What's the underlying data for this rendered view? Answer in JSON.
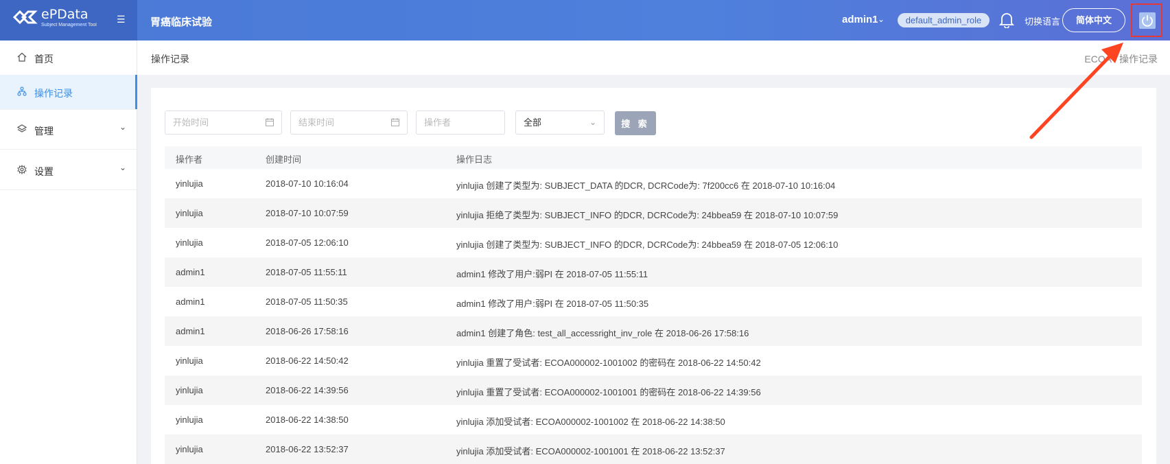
{
  "header": {
    "logo_text": "ePData",
    "logo_sub": "Subject Management Tool",
    "project_title": "胃癌临床试验",
    "user": "admin1",
    "role": "default_admin_role",
    "lang_label": "切换语言",
    "lang_button": "简体中文",
    "accent": "#4a78d6"
  },
  "sidebar": {
    "items": [
      {
        "label": "首页",
        "icon": "home-icon"
      },
      {
        "label": "操作记录",
        "icon": "sitemap-icon"
      },
      {
        "label": "管理",
        "icon": "layers-icon"
      },
      {
        "label": "设置",
        "icon": "gear-icon"
      }
    ]
  },
  "page": {
    "title": "操作记录",
    "breadcrumb": "ECOA / 操作记录"
  },
  "filters": {
    "start_placeholder": "开始时间",
    "end_placeholder": "结束时间",
    "operator_placeholder": "操作者",
    "type_value": "全部",
    "search_label": "搜 索"
  },
  "table": {
    "headers": [
      "操作者",
      "创建时间",
      "操作日志"
    ],
    "rows": [
      [
        "yinlujia",
        "2018-07-10 10:16:04",
        "yinlujia 创建了类型为: SUBJECT_DATA 的DCR, DCRCode为: 7f200cc6 在 2018-07-10 10:16:04"
      ],
      [
        "yinlujia",
        "2018-07-10 10:07:59",
        "yinlujia 拒绝了类型为: SUBJECT_INFO 的DCR, DCRCode为: 24bbea59 在 2018-07-10 10:07:59"
      ],
      [
        "yinlujia",
        "2018-07-05 12:06:10",
        "yinlujia 创建了类型为: SUBJECT_INFO 的DCR, DCRCode为: 24bbea59 在 2018-07-05 12:06:10"
      ],
      [
        "admin1",
        "2018-07-05 11:55:11",
        "admin1 修改了用户:弱PI 在 2018-07-05 11:55:11"
      ],
      [
        "admin1",
        "2018-07-05 11:50:35",
        "admin1 修改了用户:弱PI 在 2018-07-05 11:50:35"
      ],
      [
        "admin1",
        "2018-06-26 17:58:16",
        "admin1 创建了角色: test_all_accessright_inv_role 在 2018-06-26 17:58:16"
      ],
      [
        "yinlujia",
        "2018-06-22 14:50:42",
        "yinlujia 重置了受试者: ECOA000002-1001002 的密码在 2018-06-22 14:50:42"
      ],
      [
        "yinlujia",
        "2018-06-22 14:39:56",
        "yinlujia 重置了受试者: ECOA000002-1001001 的密码在 2018-06-22 14:39:56"
      ],
      [
        "yinlujia",
        "2018-06-22 14:38:50",
        "yinlujia 添加受试者: ECOA000002-1001002 在 2018-06-22 14:38:50"
      ],
      [
        "yinlujia",
        "2018-06-22 13:52:37",
        "yinlujia 添加受试者: ECOA000002-1001001 在 2018-06-22 13:52:37"
      ]
    ]
  }
}
